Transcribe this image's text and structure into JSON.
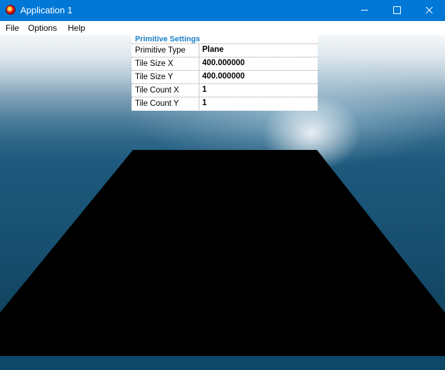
{
  "window": {
    "title": "Application 1",
    "icon": "application-icon"
  },
  "menu": {
    "items": [
      "File",
      "Options",
      "Help"
    ]
  },
  "properties": {
    "header": "Primitive Settings",
    "rows": [
      {
        "name": "Primitive Type",
        "value": "Plane"
      },
      {
        "name": "Tile Size X",
        "value": "400.000000"
      },
      {
        "name": "Tile Size Y",
        "value": "400.000000"
      },
      {
        "name": "Tile Count X",
        "value": "1"
      },
      {
        "name": "Tile Count Y",
        "value": "1"
      }
    ]
  },
  "colors": {
    "titlebar": "#0078d7",
    "header_text": "#1a7fc7",
    "plane": "#000000"
  }
}
